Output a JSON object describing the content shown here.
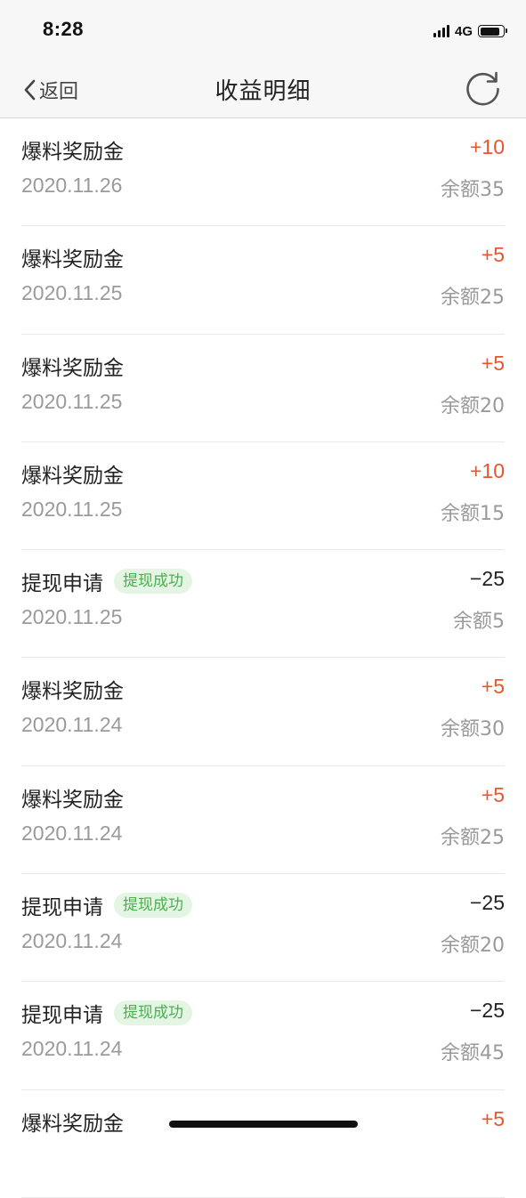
{
  "status_bar": {
    "time": "8:28",
    "network": "4G",
    "battery_level": 0.85
  },
  "nav": {
    "back_label": "返回",
    "title": "收益明细",
    "back_icon": "chevron-left-icon",
    "refresh_icon": "refresh-icon"
  },
  "colors": {
    "income": "#e8552d",
    "expense": "#222222",
    "badge_text": "#4caf50",
    "badge_bg": "#e4f5e3"
  },
  "records": [
    {
      "title": "爆料奖励金",
      "badge": "",
      "date": "2020.11.26",
      "amount": "+10",
      "type": "income",
      "balance": "余额35"
    },
    {
      "title": "爆料奖励金",
      "badge": "",
      "date": "2020.11.25",
      "amount": "+5",
      "type": "income",
      "balance": "余额25"
    },
    {
      "title": "爆料奖励金",
      "badge": "",
      "date": "2020.11.25",
      "amount": "+5",
      "type": "income",
      "balance": "余额20"
    },
    {
      "title": "爆料奖励金",
      "badge": "",
      "date": "2020.11.25",
      "amount": "+10",
      "type": "income",
      "balance": "余额15"
    },
    {
      "title": "提现申请",
      "badge": "提现成功",
      "date": "2020.11.25",
      "amount": "−25",
      "type": "expense",
      "balance": "余额5"
    },
    {
      "title": "爆料奖励金",
      "badge": "",
      "date": "2020.11.24",
      "amount": "+5",
      "type": "income",
      "balance": "余额30"
    },
    {
      "title": "爆料奖励金",
      "badge": "",
      "date": "2020.11.24",
      "amount": "+5",
      "type": "income",
      "balance": "余额25"
    },
    {
      "title": "提现申请",
      "badge": "提现成功",
      "date": "2020.11.24",
      "amount": "−25",
      "type": "expense",
      "balance": "余额20"
    },
    {
      "title": "提现申请",
      "badge": "提现成功",
      "date": "2020.11.24",
      "amount": "−25",
      "type": "expense",
      "balance": "余额45"
    },
    {
      "title": "爆料奖励金",
      "badge": "",
      "date": "",
      "amount": "+5",
      "type": "income",
      "balance": ""
    }
  ]
}
